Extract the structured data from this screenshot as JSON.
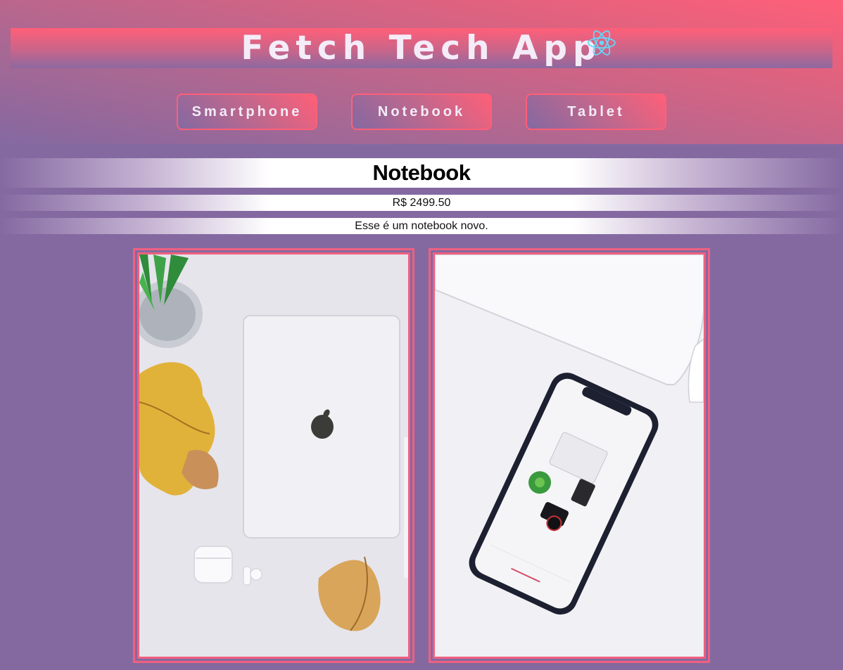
{
  "header": {
    "title": "Fetch Tech App",
    "logo_icon": "react-atom-icon"
  },
  "nav": {
    "buttons": [
      {
        "label": "Smartphone"
      },
      {
        "label": "Notebook"
      },
      {
        "label": "Tablet"
      }
    ]
  },
  "product": {
    "name": "Notebook",
    "price": "R$ 2499.50",
    "description": "Esse é um notebook novo."
  },
  "gallery": {
    "images": [
      {
        "subject": "laptop-with-airpods-and-leaves"
      },
      {
        "subject": "smartphone-on-desk"
      }
    ]
  },
  "colors": {
    "accent": "#ff5f78",
    "background": "#8469a1",
    "title_text": "#f4ecf8",
    "react_blue": "#61dafb"
  }
}
